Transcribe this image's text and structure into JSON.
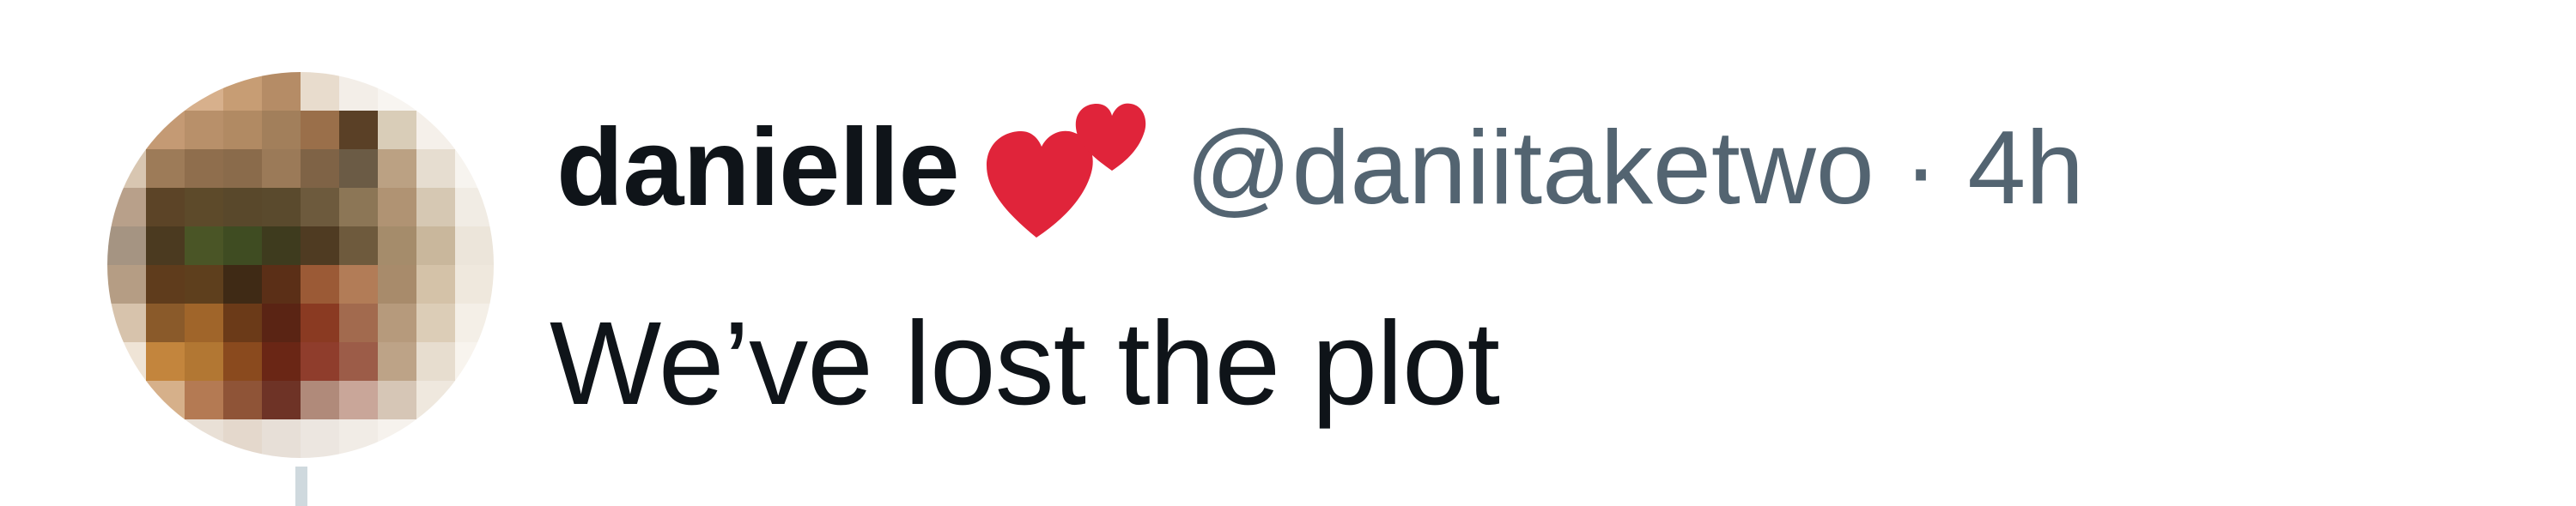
{
  "tweet": {
    "author_name": "danielle",
    "name_emoji": "two-hearts-icon",
    "handle": "@daniitaketwo",
    "separator": "·",
    "time": "4h",
    "text": "We’ve lost the plot"
  },
  "colors": {
    "text_primary": "#0f1419",
    "text_secondary": "#536471",
    "heart": "#e0243a",
    "thread_line": "#cfd9de"
  },
  "avatar": {
    "style": "pixelated-blurred-photo"
  }
}
